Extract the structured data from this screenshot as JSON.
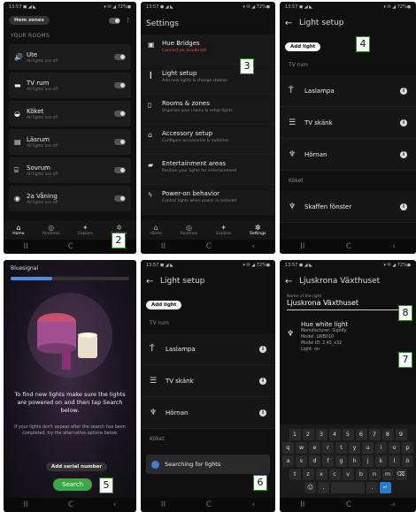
{
  "p1": {
    "status_left": "13:57 ◼ ◢ ◣",
    "status_right": "▾ ✉ ◢ 72%◼",
    "zone_pill": "Hem zones",
    "section": "YOUR ROOMS",
    "rooms": [
      {
        "name": "Ute",
        "sub": "All lights are off",
        "icon": "🔊"
      },
      {
        "name": "TV rum",
        "sub": "All lights are off",
        "icon": "▬"
      },
      {
        "name": "Köket",
        "sub": "All lights are off",
        "icon": "◒"
      },
      {
        "name": "Läsrum",
        "sub": "All lights are off",
        "icon": "▤"
      },
      {
        "name": "Sovrum",
        "sub": "All lights are off",
        "icon": "⌸"
      },
      {
        "name": "2a Våning",
        "sub": "All lights are off",
        "icon": "◉"
      }
    ],
    "tabs": [
      {
        "label": "Home",
        "icon": "⌂"
      },
      {
        "label": "Routines",
        "icon": "◎"
      },
      {
        "label": "Explore",
        "icon": "✦"
      },
      {
        "label": "Settings",
        "icon": "✲"
      }
    ],
    "badge": "2"
  },
  "p2": {
    "status_left": "13:57 ◼ ◢ ◣",
    "status_right": "▾ ✉ ◢ 72%◼",
    "title": "Settings",
    "items": [
      {
        "name": "Hue Bridges",
        "sub": "Connect an acadbridd",
        "icon": "▣",
        "warn": true
      },
      {
        "name": "Light setup",
        "sub": "Add new lights & change stables",
        "icon": "❙",
        "warn": false
      },
      {
        "name": "Rooms & zones",
        "sub": "Organise your rooms & setup lights",
        "icon": "▯",
        "warn": false
      },
      {
        "name": "Accessory setup",
        "sub": "Configure accessories & switches",
        "icon": "⌂",
        "warn": false
      },
      {
        "name": "Entertainment areas",
        "sub": "Position your lights for entertainment",
        "icon": "▰",
        "warn": false
      },
      {
        "name": "Power-on behavior",
        "sub": "Control lights when power is restored",
        "icon": "ϟ",
        "warn": false
      }
    ],
    "badge": "3"
  },
  "p3": {
    "status_left": "13:57 ◼ ◢ ◣",
    "status_right": "▾ ✉ ◢ 72%◼",
    "title": "Light setup",
    "add_label": "Add light",
    "room1": "TV rum",
    "lights1": [
      {
        "name": "Laslampa",
        "icon": "Ť"
      },
      {
        "name": "TV skänk",
        "icon": "☰"
      },
      {
        "name": "Hörnan",
        "icon": "♆"
      }
    ],
    "room2": "Köket",
    "lights2": [
      {
        "name": "Skaffen fönster",
        "icon": "♆"
      }
    ],
    "badge": "4"
  },
  "p4": {
    "title": "Bluesignal",
    "text_main": "To find new lights make sure the lights are powered on and then tap Search below.",
    "text_sub": "If your lights don't appear after the search has been completed, try the alternative options below.",
    "serial_btn": "Add serial number",
    "search_btn": "Search",
    "badge": "5"
  },
  "p5": {
    "status_left": "13:57 ◼ ◢ ◣",
    "status_right": "▾ ✉ ◢ 72%◼",
    "title": "Light setup",
    "add_label": "Add light",
    "room1": "TV rum",
    "lights1": [
      {
        "name": "Laslampa",
        "icon": "Ť"
      },
      {
        "name": "TV skänk",
        "icon": "☰"
      },
      {
        "name": "Hörnan",
        "icon": "♆"
      }
    ],
    "room2": "Köket",
    "searching": "Searching for lights",
    "badge": "6"
  },
  "p6": {
    "status_left": "13:57 ◼ ◢ ◣",
    "status_right": "▾ ✉ ◢ 72%◼",
    "title": "Ljuskrona Växthuset",
    "field_label": "Name of the light",
    "field_value": "Ljuskrona Växthuset",
    "light_type": "Hue white light",
    "light_details": [
      "Manufacturer: Signify",
      "Model: LWB010",
      "Model ID: 2.43_x32",
      "Light: on"
    ],
    "keyrow1": [
      "1",
      "2",
      "3",
      "4",
      "5",
      "6",
      "7",
      "8",
      "9"
    ],
    "keyrow2": [
      "q",
      "w",
      "e",
      "r",
      "t",
      "y",
      "u",
      "i",
      "o",
      "p"
    ],
    "keyrow3": [
      "a",
      "s",
      "d",
      "f",
      "g",
      "h",
      "j",
      "k",
      "l",
      "ö"
    ],
    "keyrow4": [
      "⇧",
      "z",
      "x",
      "c",
      "v",
      "b",
      "n",
      "m",
      "⌫"
    ],
    "badge8": "8",
    "badge7": "7"
  },
  "nav": {
    "back": "‹",
    "home": "C",
    "recent": "II"
  }
}
